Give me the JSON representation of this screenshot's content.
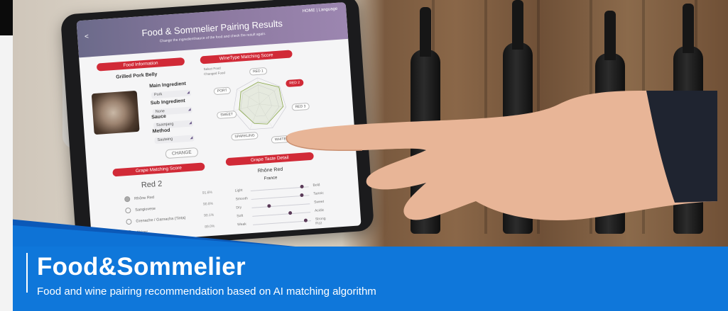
{
  "app": {
    "nav_home": "HOME",
    "nav_sep": "|",
    "nav_language": "Language",
    "back_label": "<",
    "title": "Food & Sommelier Pairing Results",
    "subtitle": "Change the ingredient/sauce of the food and check the result again."
  },
  "food_info": {
    "header": "Food Information",
    "dish": "Grilled Pork Belly",
    "main_ingredient_label": "Main Ingredient",
    "main_ingredient_value": "Pork",
    "sub_ingredient_label": "Sub Ingredient",
    "sub_ingredient_value": "None",
    "sauce_label": "Sauce",
    "sauce_value": "Ssamjang",
    "method_label": "Method",
    "method_value": "Sauteing",
    "change_button": "CHANGE"
  },
  "winetype": {
    "header": "WineType Matching Score",
    "legend_a": "Select Food",
    "legend_b": "Changed Food",
    "axes": [
      "RED 1",
      "RED 2",
      "RED 3",
      "WHITE",
      "SPARKLING",
      "SWEET",
      "PORT"
    ],
    "highlight": "RED 2"
  },
  "grape_score": {
    "header": "Grape Matching Score",
    "result": "Red 2",
    "rows": [
      {
        "label": "Rhône Red",
        "pct": "91.6%"
      },
      {
        "label": "Sangiovese",
        "pct": "90.8%"
      },
      {
        "label": "Grenache / Garnacha (Tinta)",
        "pct": "90.1%"
      },
      {
        "label": "Shiraz",
        "pct": "89.0%"
      }
    ]
  },
  "grape_taste": {
    "header": "Grape Taste Detail",
    "grape": "Rhône Red",
    "region": "France",
    "rows": [
      {
        "left": "Light",
        "right": "Bold",
        "level": 0.9
      },
      {
        "left": "Smooth",
        "right": "Tannic",
        "level": 0.88
      },
      {
        "left": "Dry",
        "right": "Sweet",
        "level": 0.28
      },
      {
        "left": "Soft",
        "right": "Acidic",
        "level": 0.65
      },
      {
        "left": "Weak",
        "right": "Strong Fizz",
        "level": 0.92
      }
    ]
  },
  "banner": {
    "title": "Food&Sommelier",
    "subtitle": "Food and wine pairing recommendation based on AI matching algorithm"
  },
  "colors": {
    "banner_blue": "#0f77da",
    "accent_red": "#d12a37",
    "header_purple": "#8d7aa1"
  }
}
